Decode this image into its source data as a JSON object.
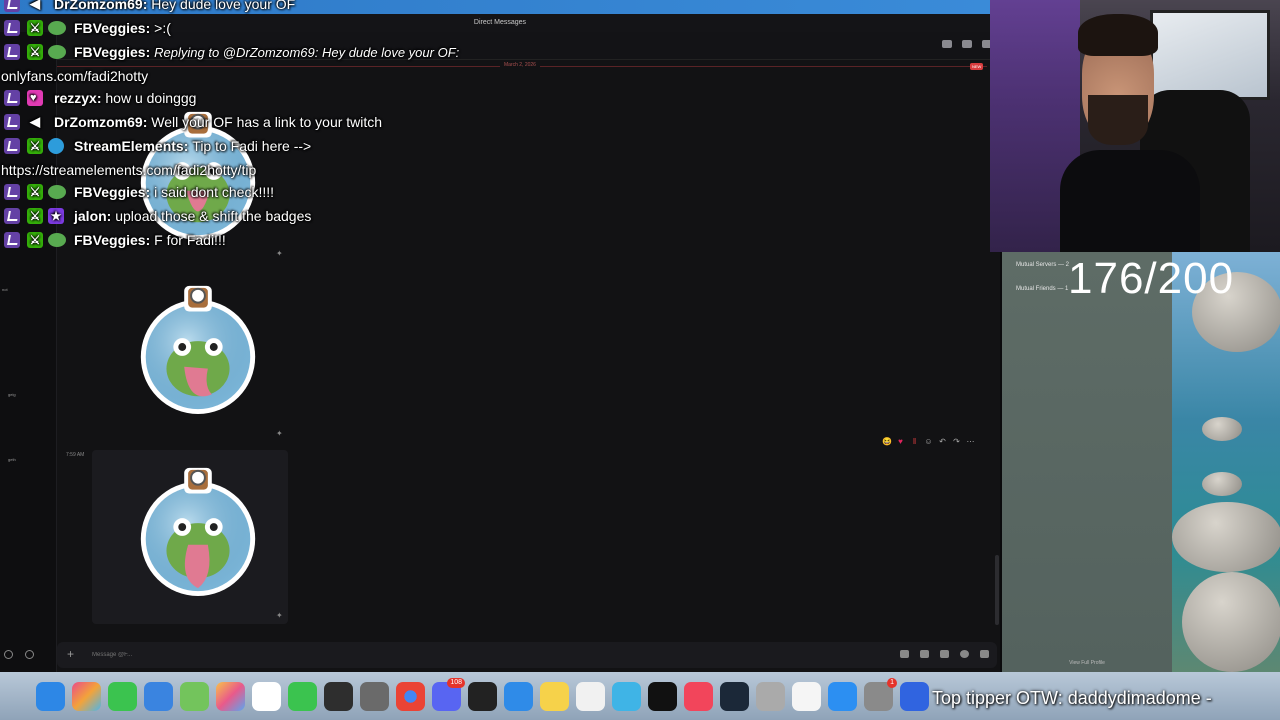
{
  "discord": {
    "window_title": "Direct Messages",
    "date_divider": "March 2, 2026",
    "new_badge": "NEW",
    "message_time": "7:59 AM",
    "composer_placeholder": "Message @F...",
    "left_labels": [
      "not",
      "geig",
      "geth"
    ],
    "mutual_servers": "Mutual Servers — 2",
    "mutual_friends": "Mutual Friends — 1",
    "view_full_profile": "View Full Profile"
  },
  "chat": [
    {
      "user": "DrZomzom69",
      "text": "Hey dude love your OF",
      "badges": [
        "twitch",
        "speaker"
      ]
    },
    {
      "user": "FBVeggies",
      "text": ">:(",
      "badges": [
        "twitch",
        "mod",
        "sub"
      ]
    },
    {
      "user": "FBVeggies",
      "text": "Replying to @DrZomzom69: Hey dude love your OF:",
      "badges": [
        "twitch",
        "mod",
        "sub"
      ],
      "reply": true
    },
    {
      "wrapped": "onlyfans.com/fadi2hotty"
    },
    {
      "user": "rezzyx",
      "text": "how u doinggg",
      "badges": [
        "twitch",
        "pink"
      ]
    },
    {
      "user": "DrZomzom69",
      "text": "Well your OF has a link to your twitch",
      "badges": [
        "twitch",
        "speaker"
      ]
    },
    {
      "user": "StreamElements",
      "text": "Tip to Fadi here -->",
      "badges": [
        "twitch",
        "mod",
        "se"
      ]
    },
    {
      "wrapped": "https://streamelements.com/fadi2hotty/tip"
    },
    {
      "user": "FBVeggies",
      "text": "i said dont check!!!!",
      "badges": [
        "twitch",
        "mod",
        "sub"
      ]
    },
    {
      "user": "jalon",
      "text": "upload those & shift the badges",
      "badges": [
        "twitch",
        "mod",
        "star"
      ]
    },
    {
      "user": "FBVeggies",
      "text": "F for Fadi!!!",
      "badges": [
        "twitch",
        "mod",
        "sub"
      ]
    }
  ],
  "counter": "176/200",
  "tipper": "Top tipper OTW: daddydimadome -",
  "dock_badges": {
    "messenger": "108",
    "settings": "1"
  },
  "colors": {
    "accent": "#6441a5",
    "mod": "#34ae0a",
    "discord_bg": "#121214",
    "new": "#d83c3e"
  }
}
